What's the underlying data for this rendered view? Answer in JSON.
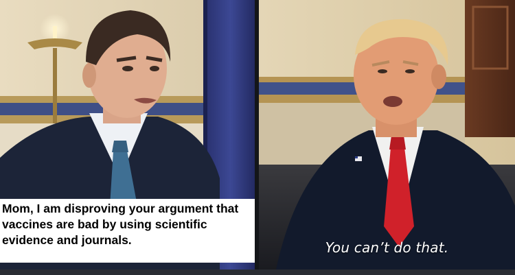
{
  "meme": {
    "top_text": "Mom, I am disproving your argument that vaccines are bad by using scientific evidence and journals.",
    "subtitle": "You can’t do that."
  },
  "panels": {
    "left": {
      "subject": "young man in suit speaking",
      "icon": "person-photo"
    },
    "right": {
      "subject": "older man with red tie responding",
      "icon": "person-photo"
    }
  },
  "colors": {
    "caption_bg": "#ffffff",
    "caption_text": "#000000",
    "subtitle_text": "#ffffff",
    "tie_left": "#3f6f93",
    "tie_right": "#d0212a"
  }
}
